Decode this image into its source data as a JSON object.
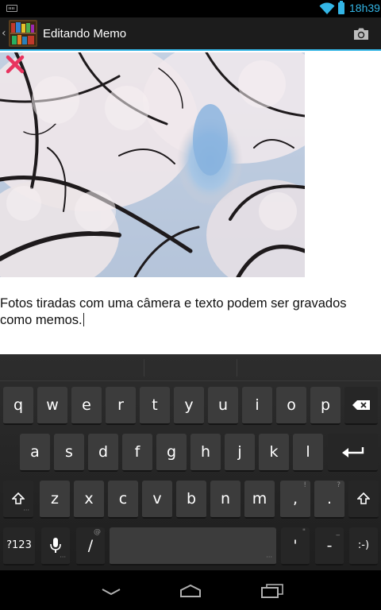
{
  "status_bar": {
    "time": "18h39"
  },
  "action_bar": {
    "title": "Editando Memo"
  },
  "memo": {
    "text": "Fotos tiradas com uma câmera e texto podem ser gravados como memos."
  },
  "keyboard": {
    "row1": [
      "q",
      "w",
      "e",
      "r",
      "t",
      "y",
      "u",
      "i",
      "o",
      "p"
    ],
    "row2": [
      "a",
      "s",
      "d",
      "f",
      "g",
      "h",
      "j",
      "k",
      "l"
    ],
    "row3": [
      "z",
      "x",
      "c",
      "v",
      "b",
      "n",
      "m",
      ",",
      "."
    ],
    "row3_hints": {
      "comma": "!",
      "period": "?"
    },
    "symbols_label": "?123",
    "slash_label": "/",
    "slash_hint": "@",
    "quote_label": "'",
    "quote_hint": "\"",
    "dash_label": "-",
    "dash_hint": "_",
    "smiley_label": ":-)"
  },
  "colors": {
    "accent": "#33b5e5",
    "delete": "#e8345f"
  }
}
